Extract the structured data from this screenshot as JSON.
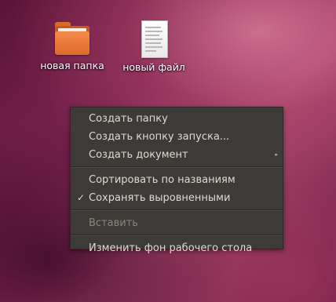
{
  "desktop": {
    "icons": [
      {
        "label": "новая папка",
        "icon": "folder-icon"
      },
      {
        "label": "новый файл",
        "icon": "text-file-icon"
      }
    ]
  },
  "context_menu": {
    "items": [
      {
        "label": "Создать папку"
      },
      {
        "label": "Создать кнопку запуска..."
      },
      {
        "label": "Создать документ",
        "submenu_icon": "▸"
      },
      {
        "label": "Сортировать по названиям"
      },
      {
        "label": "Сохранять выровненными",
        "checked": true,
        "check_mark": "✓"
      },
      {
        "label": "Вставить",
        "disabled": true
      },
      {
        "label": "Изменить фон рабочего стола"
      }
    ]
  },
  "colors": {
    "menu_background": "#3c3b37",
    "menu_text": "#dfdbd2",
    "menu_disabled_text": "#8a867d",
    "folder_orange": "#e06a2a"
  }
}
